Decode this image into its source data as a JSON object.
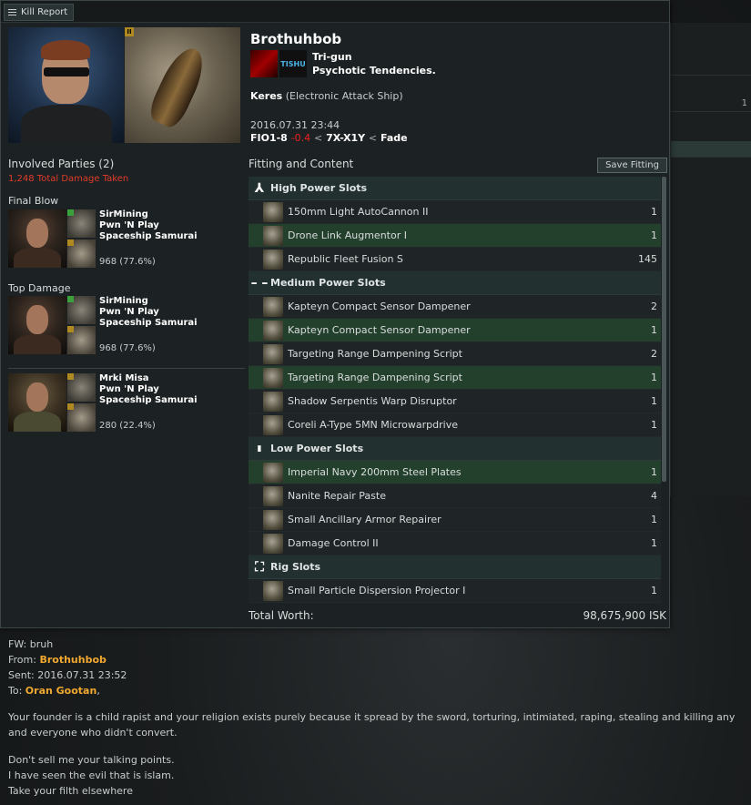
{
  "window": {
    "title": "Kill Report"
  },
  "victim": {
    "name": "Brothuhbob",
    "corporation": "Tri-gun",
    "alliance": "Psychotic Tendencies.",
    "alliance_logo_text": "TISHU",
    "ship": "Keres",
    "ship_class": "(Electronic Attack Ship)",
    "date": "2016.07.31 23:44",
    "system": "FIO1-8",
    "security": "-0.4",
    "constellation": "7X-X1Y",
    "region": "Fade",
    "sep": "<"
  },
  "involved": {
    "title": "Involved Parties (2)",
    "total_damage": "1,248 Total Damage Taken",
    "final_blow_label": "Final Blow",
    "top_damage_label": "Top Damage",
    "final_blow": {
      "name": "SirMining",
      "corp": "Pwn 'N Play",
      "alliance": "Spaceship Samurai",
      "damage": "968 (77.6%)"
    },
    "top_damage": {
      "name": "SirMining",
      "corp": "Pwn 'N Play",
      "alliance": "Spaceship Samurai",
      "damage": "968 (77.6%)"
    },
    "others": [
      {
        "name": "Mrki Misa",
        "corp": "Pwn 'N Play",
        "alliance": "Spaceship Samurai",
        "damage": "280 (22.4%)"
      }
    ]
  },
  "fitting": {
    "title": "Fitting and Content",
    "save_button": "Save Fitting",
    "high": {
      "label": "High Power Slots",
      "items": [
        {
          "name": "150mm Light AutoCannon II",
          "qty": "1",
          "dropped": false
        },
        {
          "name": "Drone Link Augmentor I",
          "qty": "1",
          "dropped": true
        },
        {
          "name": "Republic Fleet Fusion S",
          "qty": "145",
          "dropped": false
        }
      ]
    },
    "medium": {
      "label": "Medium Power Slots",
      "items": [
        {
          "name": "Kapteyn Compact Sensor Dampener",
          "qty": "2",
          "dropped": false
        },
        {
          "name": "Kapteyn Compact Sensor Dampener",
          "qty": "1",
          "dropped": true
        },
        {
          "name": "Targeting Range Dampening Script",
          "qty": "2",
          "dropped": false
        },
        {
          "name": "Targeting Range Dampening Script",
          "qty": "1",
          "dropped": true
        },
        {
          "name": "Shadow Serpentis Warp Disruptor",
          "qty": "1",
          "dropped": false
        },
        {
          "name": "Coreli A-Type 5MN Microwarpdrive",
          "qty": "1",
          "dropped": false
        }
      ]
    },
    "low": {
      "label": "Low Power Slots",
      "items": [
        {
          "name": "Imperial Navy 200mm Steel Plates",
          "qty": "1",
          "dropped": true
        },
        {
          "name": "Nanite Repair Paste",
          "qty": "4",
          "dropped": false
        },
        {
          "name": "Small Ancillary Armor Repairer",
          "qty": "1",
          "dropped": false
        },
        {
          "name": "Damage Control II",
          "qty": "1",
          "dropped": false
        }
      ]
    },
    "rig": {
      "label": "Rig Slots",
      "items": [
        {
          "name": "Small Particle Dispersion Projector I",
          "qty": "1",
          "dropped": false
        }
      ]
    },
    "total_label": "Total Worth:",
    "total_value": "98,675,900 ISK"
  },
  "mail": {
    "fw": "FW: bruh",
    "from_label": "From:",
    "from": "Brothuhbob",
    "sent_label": "Sent:",
    "sent": "2016.07.31 23:52",
    "to_label": "To:",
    "to": "Oran Gootan",
    "to_suffix": ",",
    "body1": "Your founder is a child rapist and your religion exists purely because it spread by the sword, torturing, intimiated, raping, stealing and killing any and everyone who didn't convert.",
    "body2": "Don't sell me your talking points.",
    "body3": "I have seen the evil that is islam.",
    "body4": "Take your filth elsewhere"
  },
  "background_panel": {
    "value": "1"
  }
}
